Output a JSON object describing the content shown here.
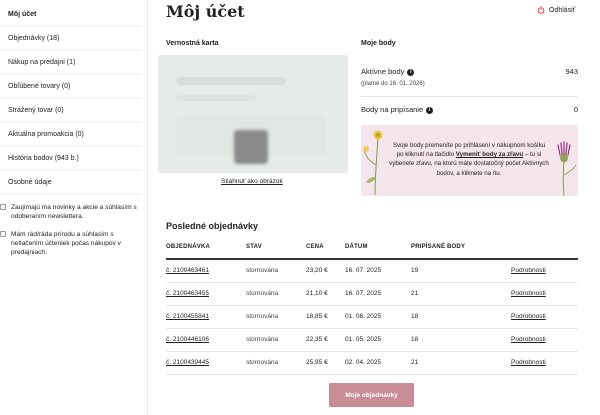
{
  "sidebar": {
    "items": [
      {
        "label": "Môj účet",
        "active": true
      },
      {
        "label": "Objednávky (18)"
      },
      {
        "label": "Nákup na predajni (1)"
      },
      {
        "label": "Obľúbené tovary (0)"
      },
      {
        "label": "Strážený tovar (0)"
      },
      {
        "label": "Aktuálna promoakcia (0)"
      },
      {
        "label": "História bodov (943 b.)"
      },
      {
        "label": "Osobné údaje"
      }
    ],
    "consents": [
      {
        "label": "Zaujímajú ma novinky a akcie a súhlasím s odoberaním newslettera.",
        "checked": false
      },
      {
        "label": "Mám rád/ráda prírodu a súhlasím s netlačením účteniek počas nákupov v predajniach.",
        "checked": false
      }
    ]
  },
  "header": {
    "title": "Môj účet",
    "logout_label": "Odhlásiť"
  },
  "card": {
    "title": "Vernostná karta",
    "download_label": "Stiahnuť ako obrázok"
  },
  "points": {
    "title": "Moje body",
    "active_label": "Aktívne body",
    "active_value": "943",
    "valid_until": "(platné do 16. 01. 2026)",
    "pending_label": "Body na pripísanie",
    "pending_value": "0",
    "promo_before": "Svoje body premeníte po prihlásení v nákupnom košíku po kliknutí na tlačidlo ",
    "promo_link": "Vymeniť body za zľavu",
    "promo_after": " – tu si vyberiete zľavu, na ktorú máte dostatočný počet Aktívnych bodov, a kliknete na ňu."
  },
  "orders": {
    "title": "Posledné objednávky",
    "columns": [
      "OBJEDNÁVKA",
      "STAV",
      "CENA",
      "DÁTUM",
      "PRIPÍSANÉ BODY"
    ],
    "rows": [
      {
        "id": "č. 2100463461",
        "status": "stornována",
        "price": "23,20 €",
        "date": "16. 07. 2025",
        "points": "19",
        "action": "Podrobnosti"
      },
      {
        "id": "č. 2100463455",
        "status": "stornována",
        "price": "21,10 €",
        "date": "16. 07. 2025",
        "points": "21",
        "action": "Podrobnosti"
      },
      {
        "id": "č. 2100455841",
        "status": "stornována",
        "price": "18,85 €",
        "date": "01. 06. 2025",
        "points": "18",
        "action": "Podrobnosti"
      },
      {
        "id": "č. 2100446106",
        "status": "stornována",
        "price": "22,35 €",
        "date": "01. 05. 2025",
        "points": "18",
        "action": "Podrobnosti"
      },
      {
        "id": "č. 2100439445",
        "status": "stornována",
        "price": "25,95 €",
        "date": "02. 04. 2025",
        "points": "21",
        "action": "Podrobnosti"
      }
    ],
    "button_label": "Moje objednávky"
  },
  "colors": {
    "accent_button": "#c98d98",
    "promo_background": "#f4e6ec",
    "logout_icon": "#d0344a"
  }
}
